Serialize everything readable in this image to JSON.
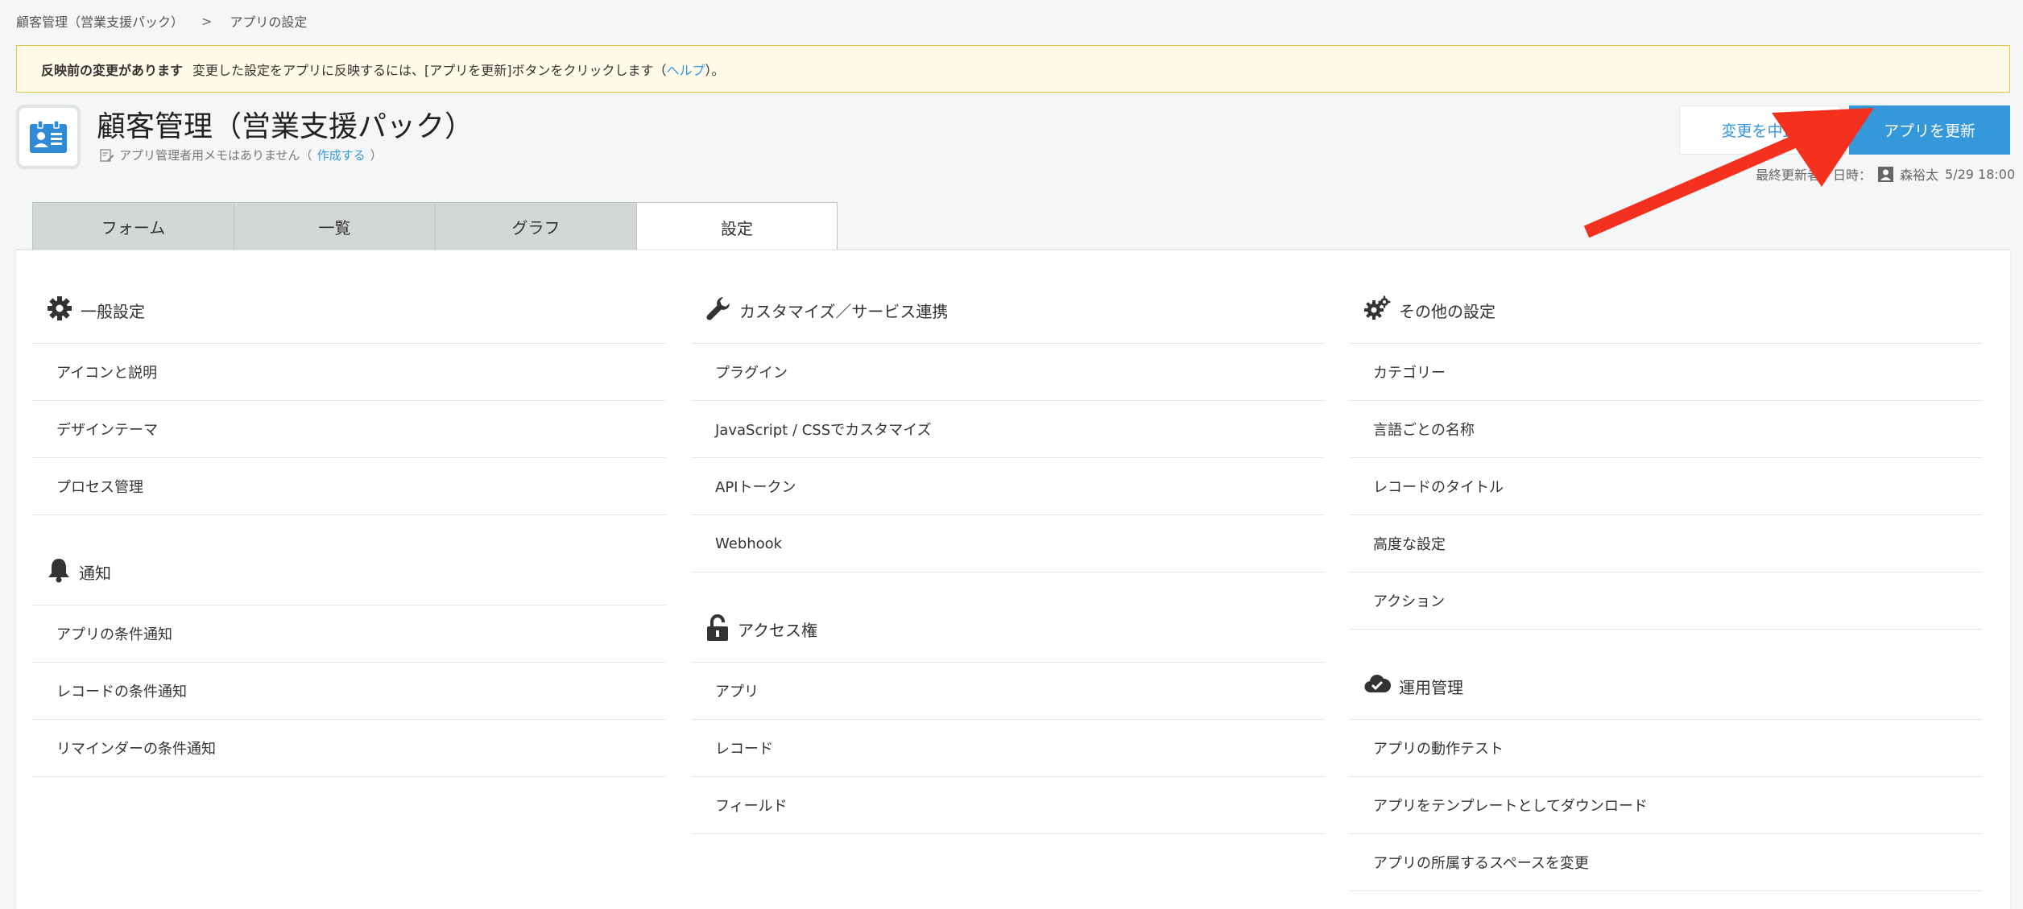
{
  "breadcrumb": {
    "app": "顧客管理（営業支援パック）",
    "separator": ">",
    "current": "アプリの設定"
  },
  "notice": {
    "title": "反映前の変更があります",
    "message_prefix": "変更した設定をアプリに反映するには、[アプリを更新]ボタンをクリックします（",
    "help_link": "ヘルプ",
    "message_suffix": "）。"
  },
  "app": {
    "title": "顧客管理（営業支援パック）",
    "memo_text": "アプリ管理者用メモはありません（",
    "memo_link": "作成する",
    "memo_suffix": "）"
  },
  "actions": {
    "cancel_label": "変更を中止",
    "update_label": "アプリを更新"
  },
  "last_updated": {
    "label": "最終更新者／日時：",
    "user": "森裕太",
    "datetime": "5/29 18:00"
  },
  "tabs": [
    {
      "label": "フォーム"
    },
    {
      "label": "一覧"
    },
    {
      "label": "グラフ"
    },
    {
      "label": "設定"
    }
  ],
  "sections": {
    "general": {
      "title": "一般設定",
      "items": [
        "アイコンと説明",
        "デザインテーマ",
        "プロセス管理"
      ]
    },
    "notification": {
      "title": "通知",
      "items": [
        "アプリの条件通知",
        "レコードの条件通知",
        "リマインダーの条件通知"
      ]
    },
    "customize": {
      "title": "カスタマイズ／サービス連携",
      "items": [
        "プラグイン",
        "JavaScript / CSSでカスタマイズ",
        "APIトークン",
        "Webhook"
      ]
    },
    "access": {
      "title": "アクセス権",
      "items": [
        "アプリ",
        "レコード",
        "フィールド"
      ]
    },
    "other": {
      "title": "その他の設定",
      "items": [
        "カテゴリー",
        "言語ごとの名称",
        "レコードのタイトル",
        "高度な設定",
        "アクション"
      ]
    },
    "operation": {
      "title": "運用管理",
      "items": [
        "アプリの動作テスト",
        "アプリをテンプレートとしてダウンロード",
        "アプリの所属するスペースを変更"
      ]
    }
  },
  "colors": {
    "accent": "#3498db",
    "notice_bg": "#fffbe8",
    "notice_border": "#e8c34a",
    "arrow": "#f4301e"
  },
  "icons": {
    "app": "address-card-icon",
    "memo": "pencil-note-icon",
    "user": "user-icon",
    "general": "gear-icon",
    "notification": "bell-icon",
    "customize": "wrench-icon",
    "access": "unlock-icon",
    "other": "gears-icon",
    "operation": "cloud-check-icon"
  }
}
